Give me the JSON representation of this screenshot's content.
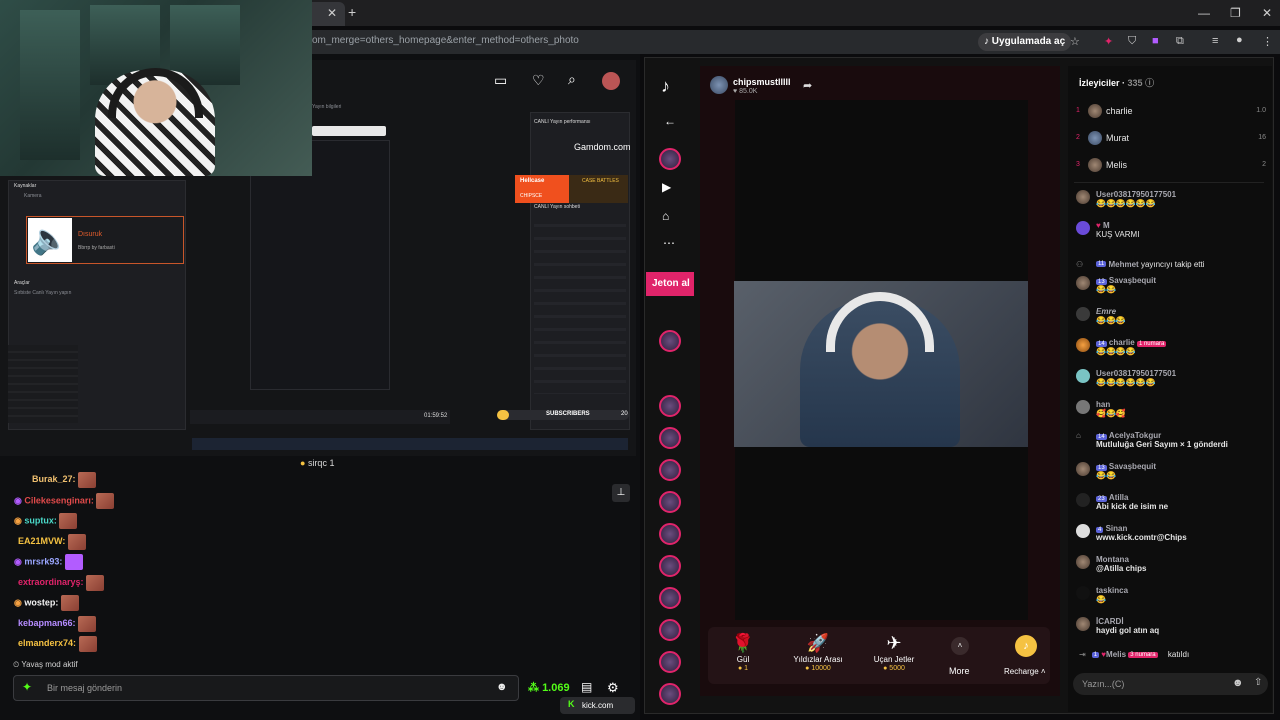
{
  "browser": {
    "url_text": "om_merge=others_homepage&enter_method=others_photo",
    "open_app_label": "Uygulamada aç",
    "tab_close": "✕",
    "new_tab": "+",
    "kick_tab_label": "kick.com"
  },
  "left_pane": {
    "obs": {
      "sources_title": "Kaynaklar",
      "source_item": "Kamera",
      "tools_title": "Araçlar",
      "tools_item": "Sırbiste Canlı Yayın yapın",
      "sound_alert_title": "Dısuruk",
      "sound_alert_sub": "Bbrrp by farbasti",
      "stream_info": "Yayın bilgileri",
      "live_perf": "CANLI Yayın performansı",
      "gamdom_label": "Gamdom.com",
      "hellcase_label": "Hellcase",
      "case_battles": "CASE BATTLES",
      "chipsce": "CHIPSCE",
      "subscribers_label": "SUBSCRIBERS",
      "subscribers_count": "20",
      "live_chat": "CANLI Yayın sohbeti",
      "time": "01:59:52"
    },
    "viewer_label": "sirqc",
    "viewer_count": "1",
    "chat": [
      {
        "user": "Burak_27:",
        "color": "#f0c070"
      },
      {
        "user": "Cilekesenginarı:",
        "color": "#e04a4a"
      },
      {
        "user": "suptux:",
        "color": "#4ad9c9"
      },
      {
        "user": "EA21MVW:",
        "color": "#f5c242"
      },
      {
        "user": "mrsrk93:",
        "color": "#9aa6ff"
      },
      {
        "user": "extraordinaryş:",
        "color": "#e0246a"
      },
      {
        "user": "wostep:",
        "color": "#f5f5f5"
      },
      {
        "user": "kebapman66:",
        "color": "#b58cff"
      },
      {
        "user": "elmanderx74:",
        "color": "#f5c242"
      }
    ],
    "slow_mode": "Yavaş mod aktif",
    "message_placeholder": "Bir mesaj gönderin",
    "points": "1.069"
  },
  "tiktok": {
    "streamer_name": "chipsmustlllll",
    "streamer_likes": "85.0K",
    "jeton_label": "Jeton al",
    "gifts": [
      {
        "name": "Gül",
        "cost": "1",
        "icon": "🌹"
      },
      {
        "name": "Yıldızlar Arası",
        "cost": "10000",
        "icon": "🚀"
      },
      {
        "name": "Uçan Jetler",
        "cost": "5000",
        "icon": "✈"
      }
    ],
    "more_label": "More",
    "recharge_label": "Recharge",
    "viewers_title": "İzleyiciler",
    "viewers_count": "335",
    "top_viewers": [
      {
        "rank": "1",
        "name": "charlie",
        "score": "1.0"
      },
      {
        "rank": "2",
        "name": "Murat",
        "score": "16"
      },
      {
        "rank": "3",
        "name": "Melis",
        "score": "2"
      }
    ],
    "chat": [
      {
        "name": "User03817950177501",
        "level": "",
        "text": "😂😂😂😂😂😂"
      },
      {
        "name": "M",
        "level": "",
        "text": "KUŞ VARMI"
      },
      {
        "name": "Mehmet",
        "level": "11",
        "text": "yayıncıyı takip etti"
      },
      {
        "name": "Savaşbequit",
        "level": "13",
        "text": "😂😂"
      },
      {
        "name": "Emre",
        "level": "",
        "text": "😂😂😂"
      },
      {
        "name": "charlie",
        "level": "14",
        "text": "😂😂😂😂"
      },
      {
        "name": "User03817950177501",
        "level": "",
        "text": "😂😂😂😂😂😂"
      },
      {
        "name": "han",
        "level": "",
        "text": "🥰😂🥰"
      },
      {
        "name": "AcelyaTokgur",
        "level": "14",
        "text": "Mutluluğa Geri Sayım × 1 gönderdi"
      },
      {
        "name": "Savaşbequit",
        "level": "13",
        "text": "😂😂"
      },
      {
        "name": "Atilla",
        "level": "23",
        "text": "Abi kick de isim ne"
      },
      {
        "name": "Sinan",
        "level": "4",
        "text": "www.kick.comtr@Chips"
      },
      {
        "name": "Montana",
        "level": "",
        "text": "@Atilla chips"
      },
      {
        "name": "taskinca",
        "level": "",
        "text": "😂"
      },
      {
        "name": "İCARDİ",
        "level": "",
        "text": "haydi gol atın aq"
      }
    ],
    "numara_badge_1": "1 numara",
    "numara_badge_3": "3 numara",
    "join_user": "Melis",
    "join_level": "1",
    "join_text": "katıldı",
    "chat_placeholder": "Yazın...(C)"
  },
  "colors": {
    "kick_green": "#53fc18",
    "tiktok_pink": "#e0246a",
    "accent_orange": "#e15c2c"
  }
}
